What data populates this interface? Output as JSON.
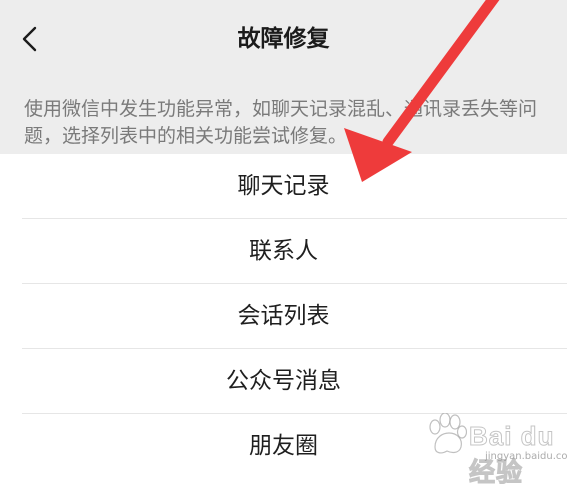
{
  "nav": {
    "title": "故障修复"
  },
  "description": "使用微信中发生功能异常，如聊天记录混乱、通讯录丢失等问题，选择列表中的相关功能尝试修复。",
  "menu": {
    "items": [
      {
        "label": "聊天记录"
      },
      {
        "label": "联系人"
      },
      {
        "label": "会话列表"
      },
      {
        "label": "公众号消息"
      },
      {
        "label": "朋友圈"
      }
    ]
  },
  "annotation": {
    "arrow_color": "#ee3b3b"
  },
  "watermark": {
    "brand_text": "Bai du 经验",
    "url": "jingyan.baidu.com"
  }
}
